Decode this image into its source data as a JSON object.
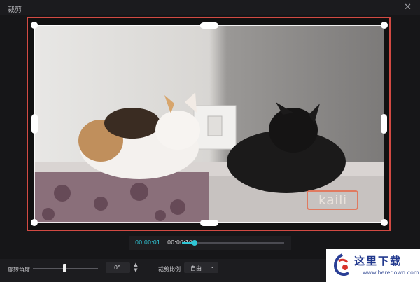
{
  "window": {
    "title": "裁剪",
    "close_symbol": "✕"
  },
  "preview": {
    "watermark_text": "kaili"
  },
  "timeline": {
    "current_time": "00:00:01",
    "separator": "|",
    "total_time": "00:00:19",
    "progress": 0.12
  },
  "controls": {
    "rotation_label": "旋转角度",
    "rotation_value": "0°",
    "rotation_fraction": 0.48,
    "ratio_label": "裁剪比例",
    "ratio_value": "自由"
  },
  "site_logo": {
    "chinese_text": "这里下载",
    "url_text": "www.heredown.com"
  },
  "colors": {
    "accent": "#30c6d6",
    "crop_highlight": "#d24a43"
  },
  "icons": {
    "close": "close-icon",
    "spinner": "stepper-icon",
    "dropdown": "chevron-down-icon",
    "logo": "logo-mark-icon"
  }
}
